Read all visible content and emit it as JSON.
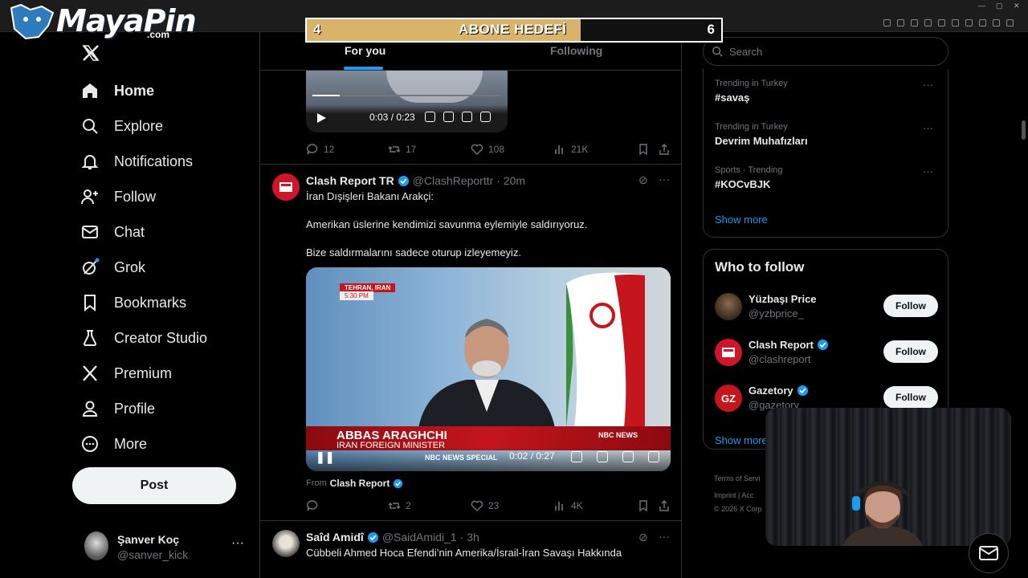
{
  "overlay": {
    "logo_text": "MayaPin",
    "logo_sub": ".com",
    "goal_title": "ABONE HEDEFİ",
    "goal_current": "4",
    "goal_target": "6",
    "goal_progress": 0.66
  },
  "nav": {
    "items": [
      {
        "label": "Home",
        "icon": "home-icon",
        "active": true
      },
      {
        "label": "Explore",
        "icon": "search-icon"
      },
      {
        "label": "Notifications",
        "icon": "bell-icon"
      },
      {
        "label": "Follow",
        "icon": "add-person-icon"
      },
      {
        "label": "Chat",
        "icon": "mail-icon"
      },
      {
        "label": "Grok",
        "icon": "grok-icon"
      },
      {
        "label": "Bookmarks",
        "icon": "bookmark-icon"
      },
      {
        "label": "Creator Studio",
        "icon": "flask-icon"
      },
      {
        "label": "Premium",
        "icon": "x-icon"
      },
      {
        "label": "Profile",
        "icon": "person-icon"
      },
      {
        "label": "More",
        "icon": "more-circle-icon"
      }
    ],
    "post_label": "Post"
  },
  "user": {
    "name": "Şanver Koç",
    "handle": "@sanver_kick"
  },
  "timeline": {
    "tabs": [
      {
        "label": "For you"
      },
      {
        "label": "Following"
      }
    ],
    "tweet1": {
      "video_time": "0:03 / 0:23",
      "replies": "12",
      "reposts": "17",
      "likes": "108",
      "views": "21K"
    },
    "tweet2": {
      "name": "Clash Report TR",
      "handle": "@ClashReporttr",
      "time": "· 20m",
      "lines": [
        "İran Dışişleri Bakanı Arakçi:",
        "Amerikan üslerine kendimizi savunma eylemiyle saldırıyoruz.",
        "Bize saldırmalarını sadece oturup izleyemeyiz."
      ],
      "video": {
        "location": "TEHRAN, IRAN",
        "clock": "5:30 PM",
        "lower_name": "ABBAS ARAGHCHI",
        "lower_title": "IRAN FOREIGN MINISTER",
        "network": "NBC NEWS",
        "ticker": "NBC NEWS SPECIAL",
        "time": "0:02 / 0:27"
      },
      "from_label": "From",
      "from_source": "Clash Report",
      "replies": "",
      "reposts": "2",
      "likes": "23",
      "views": "4K"
    },
    "tweet3": {
      "name": "Saîd Amidî",
      "handle": "@SaidAmidi_1",
      "time": "· 3h",
      "text": "Cübbeli Ahmed Hoca Efendi’nin Amerika/İsrail-İran Savaşı Hakkında"
    }
  },
  "sidebar": {
    "search_placeholder": "Search",
    "trends": [
      {
        "category": "Trending in Turkey",
        "name": "#savaş"
      },
      {
        "category": "Trending in Turkey",
        "name": "Devrim Muhafızları"
      },
      {
        "category": "Sports · Trending",
        "name": "#KOCvBJK"
      }
    ],
    "show_more": "Show more",
    "who_to_follow_title": "Who to follow",
    "who_to_follow": [
      {
        "name": "Yüzbaşı Price",
        "handle": "@yzbprice_",
        "verified": false,
        "button": "Follow"
      },
      {
        "name": "Clash Report",
        "handle": "@clashreport",
        "verified": true,
        "button": "Follow"
      },
      {
        "name": "Gazetory",
        "handle": "@gazetory",
        "verified": true,
        "button": "Follow"
      }
    ],
    "show_more2": "Show more",
    "footer_line1": "Terms of Servi",
    "footer_line2": "Imprint  |  Acc",
    "footer_line3": "© 2026 X Corp"
  },
  "colors": {
    "accent": "#1d9bf0",
    "background": "#000000",
    "border": "#2f3336",
    "muted": "#71767b"
  }
}
